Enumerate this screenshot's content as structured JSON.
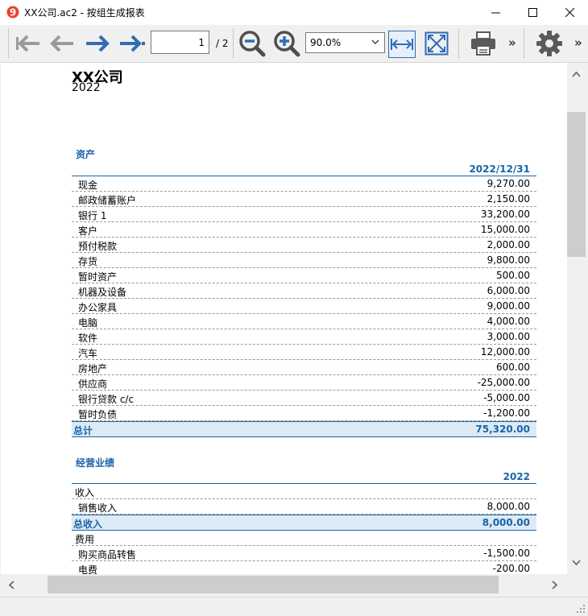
{
  "window": {
    "title": "XX公司.ac2 - 按组生成报表"
  },
  "toolbar": {
    "page_current": "1",
    "page_total": "/ 2",
    "zoom": "90.0%",
    "icons": [
      "first-page-icon",
      "previous-page-icon",
      "next-page-icon",
      "last-page-icon",
      "zoom-out-icon",
      "zoom-in-icon",
      "fit-width-icon",
      "fit-page-icon",
      "print-icon",
      "settings-icon"
    ]
  },
  "report": {
    "company": "XX公司",
    "year": "2022",
    "assets": {
      "title": "资产",
      "column": "2022/12/31",
      "rows": [
        {
          "label": "现金",
          "value": "9,270.00"
        },
        {
          "label": "邮政储蓄账户",
          "value": "2,150.00"
        },
        {
          "label": "银行 1",
          "value": "33,200.00"
        },
        {
          "label": "客户",
          "value": "15,000.00"
        },
        {
          "label": "预付税款",
          "value": "2,000.00"
        },
        {
          "label": "存货",
          "value": "9,800.00"
        },
        {
          "label": "暂时资产",
          "value": "500.00"
        },
        {
          "label": "机器及设备",
          "value": "6,000.00"
        },
        {
          "label": "办公家具",
          "value": "9,000.00"
        },
        {
          "label": "电脑",
          "value": "4,000.00"
        },
        {
          "label": "软件",
          "value": "3,000.00"
        },
        {
          "label": "汽车",
          "value": "12,000.00"
        },
        {
          "label": "房地产",
          "value": "600.00"
        },
        {
          "label": "供应商",
          "value": "-25,000.00"
        },
        {
          "label": "银行贷款 c/c",
          "value": "-5,000.00"
        },
        {
          "label": "暂时负债",
          "value": "-1,200.00"
        }
      ],
      "total_label": "总计",
      "total_value": "75,320.00"
    },
    "operations": {
      "title": "经营业绩",
      "column": "2022",
      "income_group": "收入",
      "income_rows": [
        {
          "label": "销售收入",
          "value": "8,000.00"
        }
      ],
      "income_total_label": "总收入",
      "income_total_value": "8,000.00",
      "expense_group": "费用",
      "expense_rows": [
        {
          "label": "购买商品转售",
          "value": "-1,500.00"
        },
        {
          "label": "电费",
          "value": "-200.00"
        }
      ]
    }
  },
  "colors": {
    "accent": "#1a64a8",
    "total_bg": "#ddeaf5",
    "nav_blue": "#2f6db5",
    "nav_gray": "#9a9a9a"
  }
}
